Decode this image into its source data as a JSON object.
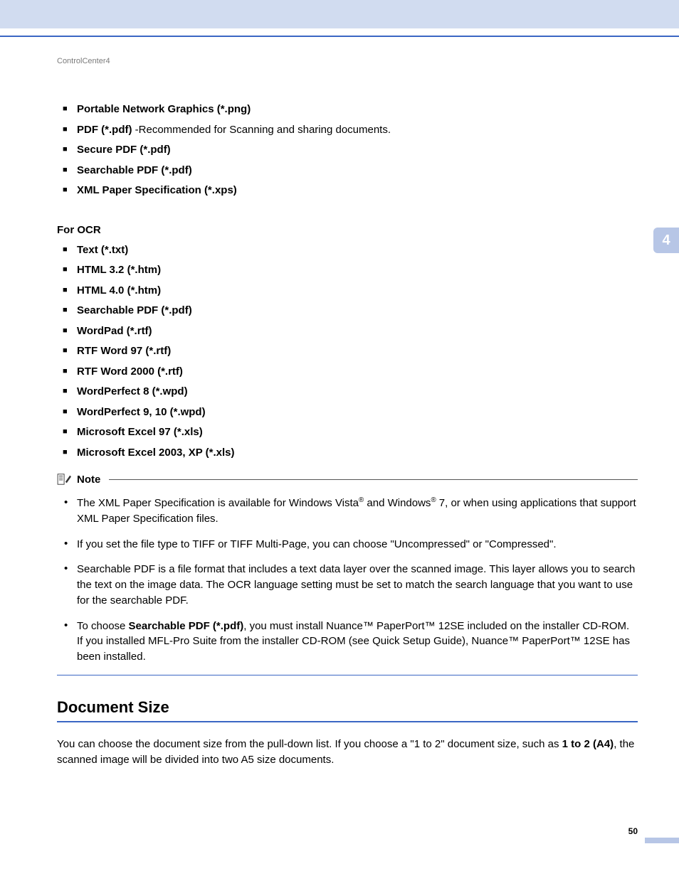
{
  "header": {
    "running": "ControlCenter4"
  },
  "chapterTab": "4",
  "list1": {
    "items": [
      {
        "bold": "Portable Network Graphics (*.png)",
        "rest": ""
      },
      {
        "bold": "PDF (*.pdf)",
        "rest": " -Recommended for Scanning and sharing documents."
      },
      {
        "bold": "Secure PDF (*.pdf)",
        "rest": ""
      },
      {
        "bold": "Searchable PDF (*.pdf)",
        "rest": ""
      },
      {
        "bold": "XML Paper Specification (*.xps)",
        "rest": ""
      }
    ]
  },
  "subhead": "For OCR",
  "list2": {
    "items": [
      "Text (*.txt)",
      "HTML 3.2 (*.htm)",
      "HTML 4.0 (*.htm)",
      "Searchable PDF (*.pdf)",
      "WordPad (*.rtf)",
      "RTF Word 97 (*.rtf)",
      "RTF Word 2000 (*.rtf)",
      "WordPerfect 8 (*.wpd)",
      "WordPerfect 9, 10 (*.wpd)",
      "Microsoft Excel 97 (*.xls)",
      "Microsoft Excel 2003, XP (*.xls)"
    ]
  },
  "note": {
    "label": "Note",
    "items": {
      "n1a": "The XML Paper Specification is available for Windows Vista",
      "n1b": " and Windows",
      "n1c": " 7, or when using applications that support XML Paper Specification files.",
      "n2": "If you set the file type to TIFF or TIFF Multi-Page, you can choose \"Uncompressed\" or \"Compressed\".",
      "n3": "Searchable PDF is a file format that includes a text data layer over the scanned image. This layer allows you to search the text on the image data. The OCR language setting must be set to match the search language that you want to use for the searchable PDF.",
      "n4a": "To choose ",
      "n4bold": "Searchable PDF (*.pdf)",
      "n4b": ", you must install Nuance™ PaperPort™ 12SE included on the installer CD-ROM. If you installed MFL-Pro Suite from the installer CD-ROM (see Quick Setup Guide), Nuance™ PaperPort™ 12SE has been installed."
    }
  },
  "section": {
    "title": "Document Size",
    "p_a": "You can choose the document size from the pull-down list. If you choose a \"1 to 2\" document size, such as ",
    "p_bold": "1 to 2 (A4)",
    "p_b": ", the scanned image will be divided into two A5 size documents."
  },
  "pageNumber": "50"
}
